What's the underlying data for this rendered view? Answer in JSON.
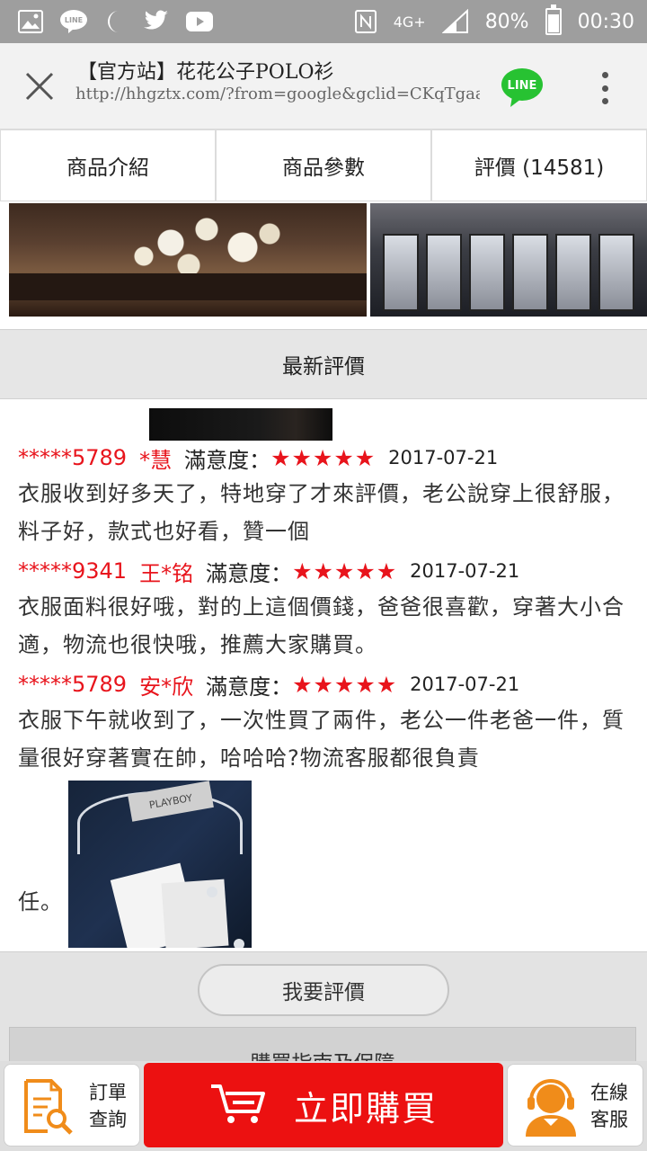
{
  "status_bar": {
    "battery": "80%",
    "time": "00:30",
    "network": "4G+",
    "icons": [
      "gallery-icon",
      "line-notification-icon",
      "moon-icon",
      "twitter-icon",
      "youtube-icon",
      "nfc-icon",
      "signal-icon",
      "battery-icon"
    ]
  },
  "browser": {
    "title": "【官方站】花花公子POLO衫",
    "url": "http://hhgztx.com/?from=google&gclid=CKqTgaa...",
    "line_label": "LINE",
    "accent": "#27c232"
  },
  "tabs": [
    {
      "label": "商品介紹"
    },
    {
      "label": "商品參數"
    },
    {
      "label": "評價 (14581)"
    }
  ],
  "section": {
    "title": "最新評價"
  },
  "reviews": [
    {
      "user": "*****5789",
      "name": "*慧",
      "rating_label": "滿意度：",
      "stars": "★★★★★",
      "date": "2017-07-21",
      "text": "衣服收到好多天了，特地穿了才來評價，老公說穿上很舒服，料子好，款式也好看，贊一個"
    },
    {
      "user": "*****9341",
      "name": "王*铭",
      "rating_label": "滿意度：",
      "stars": "★★★★★",
      "date": "2017-07-21",
      "text": "衣服面料很好哦，對的上這個價錢，爸爸很喜歡，穿著大小合適，物流也很快哦，推薦大家購買。"
    },
    {
      "user": "*****5789",
      "name": "安*欣",
      "rating_label": "滿意度：",
      "stars": "★★★★★",
      "date": "2017-07-21",
      "text": "衣服下午就收到了，一次性買了兩件，老公一件老爸一件，質量很好穿著實在帥，哈哈哈?物流客服都很負責",
      "text_tail": "任。",
      "photo_label": "PLAYBOY"
    }
  ],
  "actions": {
    "write_review": "我要評價",
    "guide": "購買指南及保障"
  },
  "bottom_bar": {
    "order_line1": "訂單",
    "order_line2": "查詢",
    "buy_now": "立即購買",
    "service_line1": "在線",
    "service_line2": "客服",
    "buy_color": "#ec1111",
    "icon_color": "#f08c1a"
  }
}
